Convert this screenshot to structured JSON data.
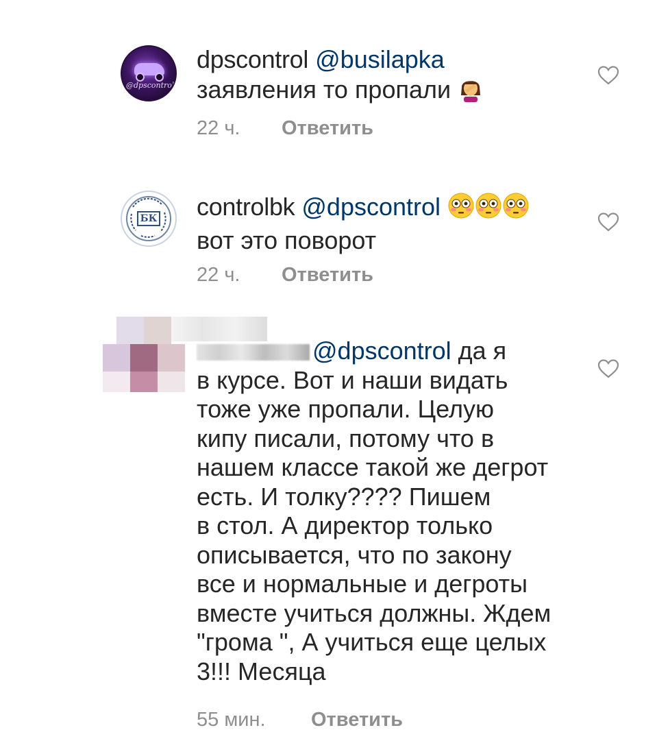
{
  "comments": [
    {
      "username": "dpscontrol",
      "mention": "@busilapka",
      "text": "заявления то пропали",
      "emoji": "facepalm-emoji",
      "time": "22 ч.",
      "reply_label": "Ответить",
      "avatar_text": "@dpscontrol"
    },
    {
      "username": "controlbk",
      "mention": "@dpscontrol",
      "text": "вот это поворот",
      "emoji": "flushed-face-emoji x3",
      "time": "22 ч.",
      "reply_label": "Ответить",
      "avatar_text": "БК"
    },
    {
      "username": "",
      "mention": "@dpscontrol",
      "text_first": "да я",
      "lines": [
        "в курсе. Вот и наши видать",
        "тоже уже пропали.  Целую",
        "кипу писали, потому что в",
        "нашем классе такой же дегрот",
        "есть. И толку???? Пишем",
        "в стол. А директор только",
        "описывается,  что по закону",
        "все и нормальные и дегроты",
        "вместе учиться должны. Ждем",
        "\"грома \", А учиться еще целых",
        "3!!! Месяца"
      ],
      "time": "55 мин.",
      "reply_label": "Ответить"
    }
  ],
  "icons": {
    "like": "heart-outline-icon"
  },
  "colors": {
    "text": "#262626",
    "mention": "#00376b",
    "secondary": "#8e8e8e"
  }
}
